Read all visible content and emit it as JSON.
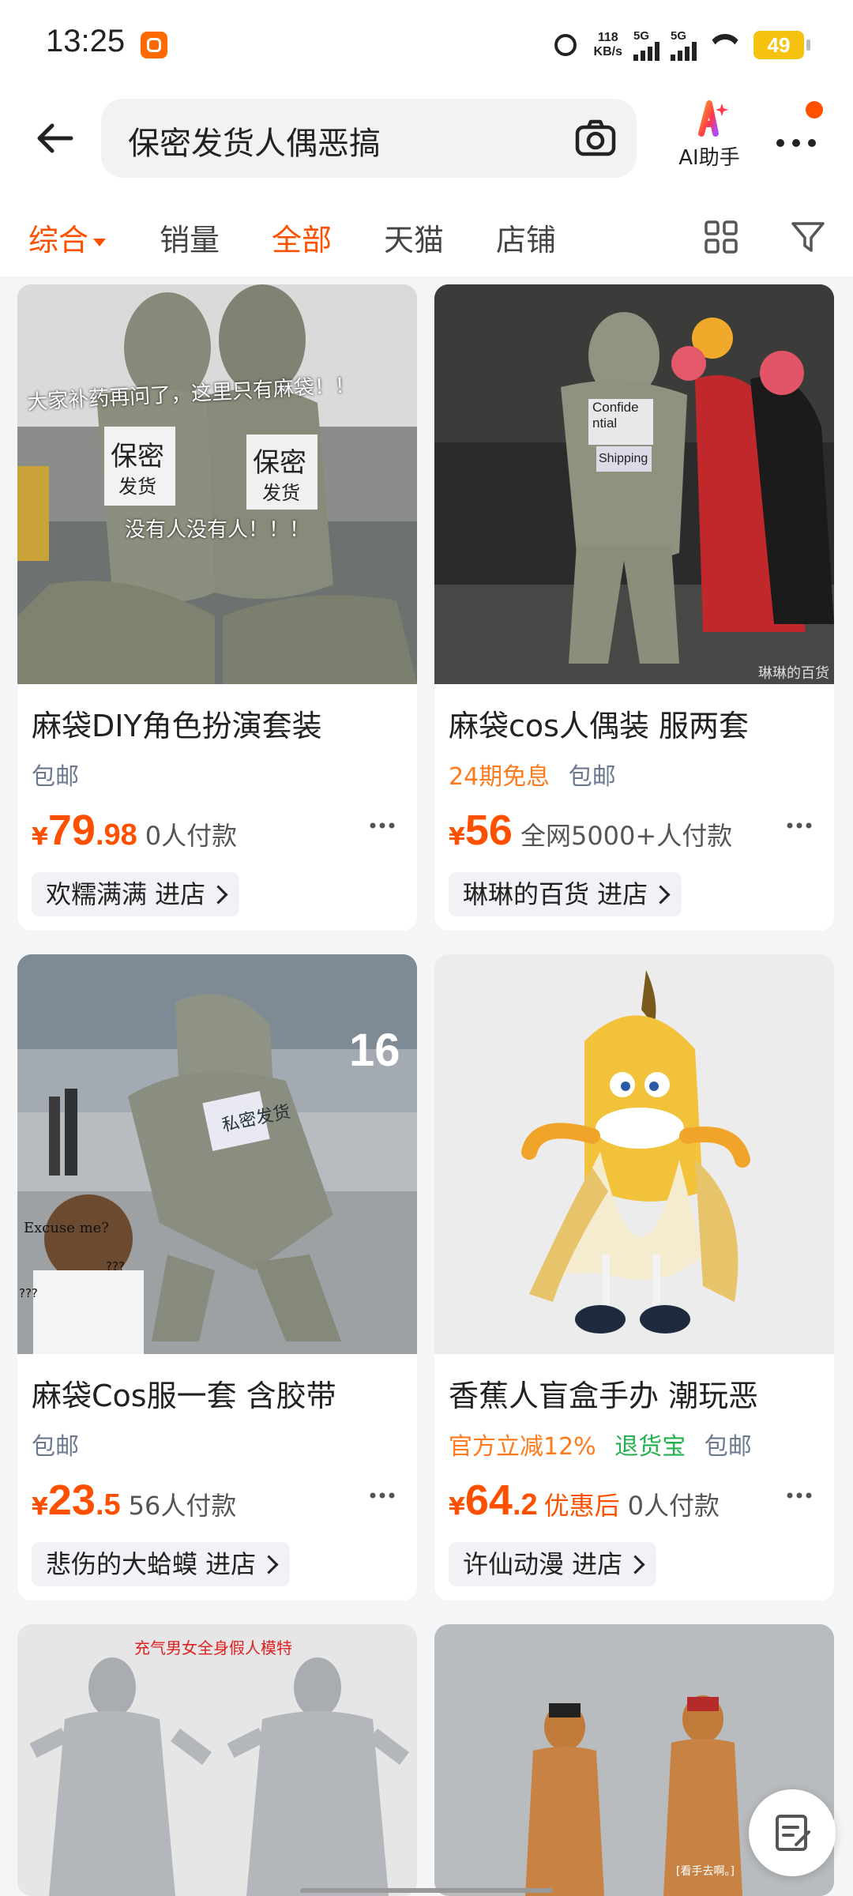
{
  "status_bar": {
    "time": "13:25",
    "net_speed_value": "118",
    "net_speed_unit": "KB/s",
    "sim1": "5G",
    "sim2": "5G",
    "battery": "49"
  },
  "header": {
    "search_query": "保密发货人偶恶搞",
    "ai_label": "AI助手"
  },
  "tabs": [
    {
      "label": "综合"
    },
    {
      "label": "销量"
    },
    {
      "label": "全部"
    },
    {
      "label": "天猫"
    },
    {
      "label": "店铺"
    }
  ],
  "products": [
    {
      "title": "麻袋DIY角色扮演套装",
      "tags": [
        {
          "text": "包邮",
          "color": "#6b7a8f"
        }
      ],
      "price_symbol": "¥",
      "price_int": "79",
      "price_dec": ".98",
      "price_note": "",
      "sales": "0人付款",
      "shop": "欢糯满满 进店",
      "image_text": {
        "line1": "大家补药再问了，这里只有麻袋！！",
        "line2": "没有人没有人！！！",
        "sign_a": "保密",
        "sign_a2": "发货",
        "sign_b": "保密",
        "sign_b2": "发货"
      }
    },
    {
      "title": "麻袋cos人偶装 服两套",
      "tags": [
        {
          "text": "24期免息",
          "color": "#ff7a1a"
        },
        {
          "text": "包邮",
          "color": "#6b7a8f"
        }
      ],
      "price_symbol": "¥",
      "price_int": "56",
      "price_dec": "",
      "price_note": "",
      "sales": "全网5000+人付款",
      "shop": "琳琳的百货 进店",
      "image_text": {
        "label1": "Confide\nntial",
        "label2": "Shipping",
        "watermark": "琳琳的百货"
      }
    },
    {
      "title": "麻袋Cos服一套 含胶带",
      "tags": [
        {
          "text": "包邮",
          "color": "#6b7a8f"
        }
      ],
      "price_symbol": "¥",
      "price_int": "23",
      "price_dec": ".5",
      "price_note": "",
      "sales": "56人付款",
      "shop": "悲伤的大蛤蟆 进店",
      "image_text": {
        "sign": "私密发货",
        "meme": "Excuse me?",
        "q1": "???",
        "q2": "???",
        "number": "16"
      }
    },
    {
      "title": "香蕉人盲盒手办 潮玩恶",
      "tags": [
        {
          "text": "官方立减12%",
          "color": "#ff7a1a"
        },
        {
          "text": "退货宝",
          "color": "#25b050"
        },
        {
          "text": "包邮",
          "color": "#6b7a8f"
        }
      ],
      "price_symbol": "¥",
      "price_int": "64",
      "price_dec": ".2",
      "price_note": "优惠后",
      "sales": "0人付款",
      "shop": "许仙动漫 进店",
      "image_text": {}
    },
    {
      "title": "",
      "image_text": {
        "headline": "充气男女全身假人模特"
      }
    },
    {
      "title": "",
      "image_text": {
        "caption": "[看手去啊。]"
      }
    }
  ],
  "colors": {
    "accent": "#ff5000",
    "tag_orange": "#ff7a1a",
    "tag_green": "#25b050"
  }
}
